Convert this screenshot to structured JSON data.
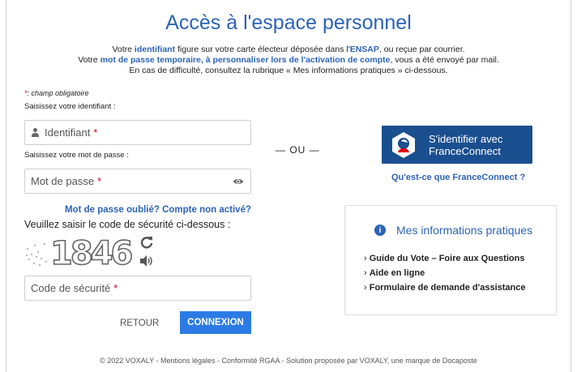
{
  "page": {
    "title": "Accès à l'espace personnel",
    "intro": {
      "line1_a": "Votre ",
      "line1_hl1": "identifiant",
      "line1_b": " figure sur votre carte électeur déposée dans l'",
      "line1_hl2": "ENSAP",
      "line1_c": ", ou reçue par courrier.",
      "line2_a": "Votre ",
      "line2_hl": "mot de passe temporaire, à personnaliser lors de l'activation de compte",
      "line2_b": ", vous a été envoyé par mail.",
      "line3": "En cas de difficulté, consultez la rubrique « Mes informations pratiques » ci-dessous."
    }
  },
  "form": {
    "required_star": "*",
    "required_note": ": champ obligatoire",
    "id_label": "Saisissez votre identifiant :",
    "id_placeholder": "Identifiant",
    "password_label": "Saisissez votre mot de passe :",
    "password_placeholder": "Mot de passe",
    "forgot_link": "Mot de passe oublié? Compte non activé?",
    "captcha_label": "Veuillez saisir le code de sécurité ci-dessous :",
    "captcha_code": "1846",
    "captcha_placeholder": "Code de sécurité",
    "retour_label": "RETOUR",
    "connexion_label": "CONNEXION"
  },
  "separator": "— OU —",
  "franceconnect": {
    "line1": "S'identifier avec",
    "line2": "FranceConnect",
    "link": "Qu'est-ce que FranceConnect ?"
  },
  "info": {
    "title": "Mes informations pratiques",
    "icon_glyph": "i",
    "items": [
      "Guide du Vote – Foire aux Questions",
      "Aide en ligne",
      "Formulaire de demande d'assistance"
    ]
  },
  "footer": "© 2022 VOXALY - Mentions légales - Conformité RGAA - Solution proposée par VOXALY, une marque de Docaposte",
  "colors": {
    "accent": "#2c63b6",
    "button": "#2c7be5",
    "franceconnect": "#1a4f8f",
    "required": "#d0021b"
  }
}
